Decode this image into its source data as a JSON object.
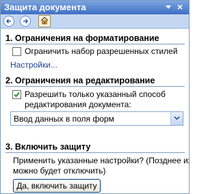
{
  "pane": {
    "title": "Защита документа"
  },
  "nav": {
    "back_icon": "back-arrow-icon",
    "forward_icon": "forward-arrow-icon",
    "home_icon": "home-icon"
  },
  "section1": {
    "title": "1. Ограничения на форматирование",
    "checkbox_label": "Ограничить набор разрешенных стилей",
    "checked": false,
    "settings_link": "Настройки..."
  },
  "section2": {
    "title": "2. Ограничения на редактирование",
    "checkbox_label_line1": "Разрешить только указанный способ",
    "checkbox_label_line2": "редактирования документа:",
    "checked": true,
    "dropdown_value": "Ввод данных в поля форм"
  },
  "section3": {
    "title": "3. Включить защиту",
    "desc_line1": "Применить указанные настройки? (Позднее их",
    "desc_line2": "можно будет отключить)",
    "button_label": "Да, включить защиту"
  },
  "colors": {
    "titlebar": "#3f6fc4",
    "navbar": "#c3d6f2",
    "link": "#1a3f9a"
  }
}
